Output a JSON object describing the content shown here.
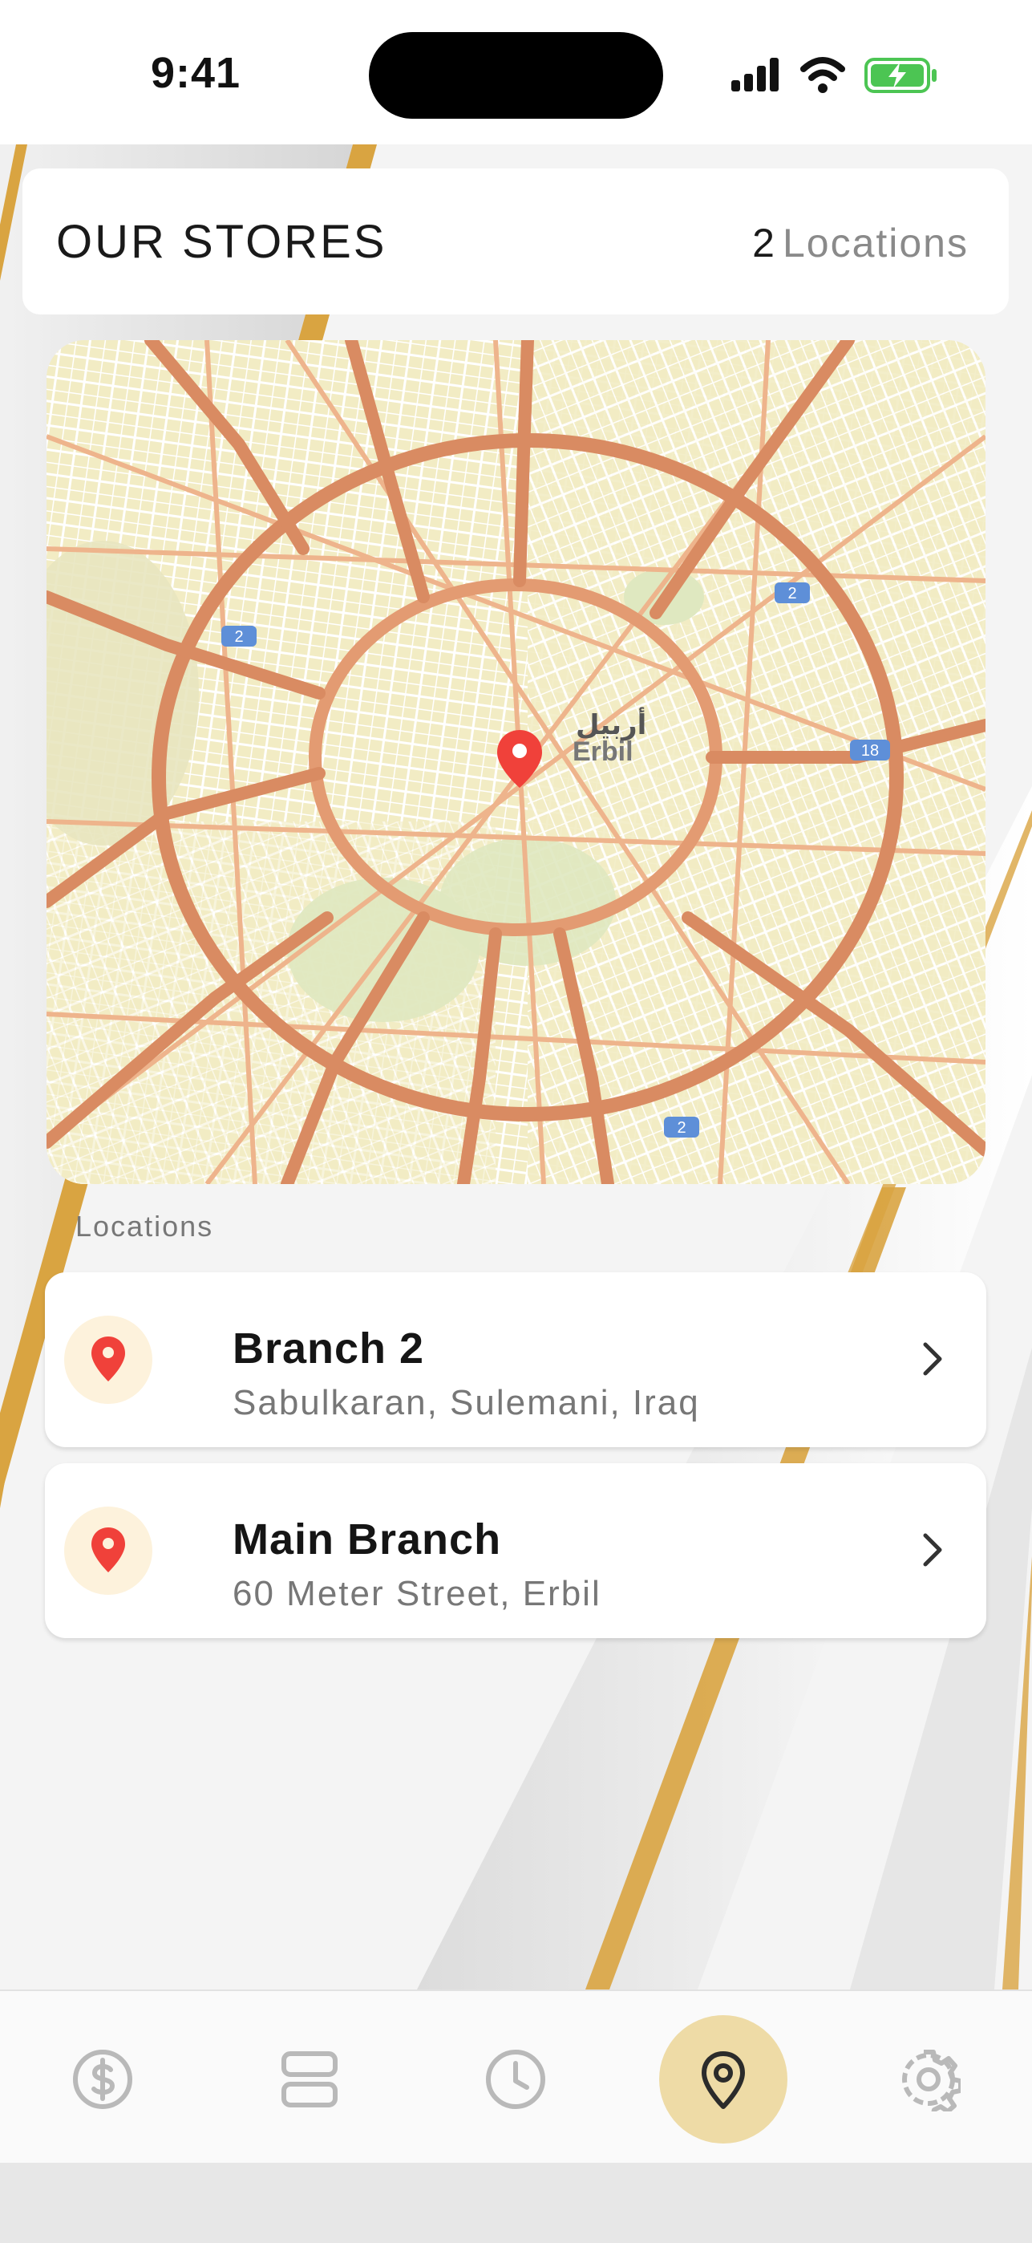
{
  "status_bar": {
    "time": "9:41"
  },
  "header": {
    "title": "OUR STORES",
    "location_count": "2",
    "location_count_label": "Locations"
  },
  "map": {
    "city_label_ar": "أربيل",
    "city_label_en": "Erbil",
    "road_badges": [
      "2",
      "2",
      "18",
      "2"
    ],
    "pin_color": "#f0413a"
  },
  "locations_section": {
    "label": "Locations",
    "items": [
      {
        "name": "Branch 2",
        "address": "Sabulkaran, Sulemani, Iraq"
      },
      {
        "name": "Main Branch",
        "address": "60 Meter Street, Erbil"
      }
    ]
  },
  "bottom_nav": {
    "items": [
      {
        "icon": "dollar-circle-icon",
        "active": false
      },
      {
        "icon": "list-rows-icon",
        "active": false
      },
      {
        "icon": "clock-icon",
        "active": false
      },
      {
        "icon": "location-pin-icon",
        "active": true
      },
      {
        "icon": "gear-icon",
        "active": false
      }
    ],
    "active_color": "#eedba6"
  },
  "colors": {
    "accent_gold": "#d9a441",
    "pin_red": "#f0413a",
    "pin_circle_bg": "#fdf2dc"
  }
}
